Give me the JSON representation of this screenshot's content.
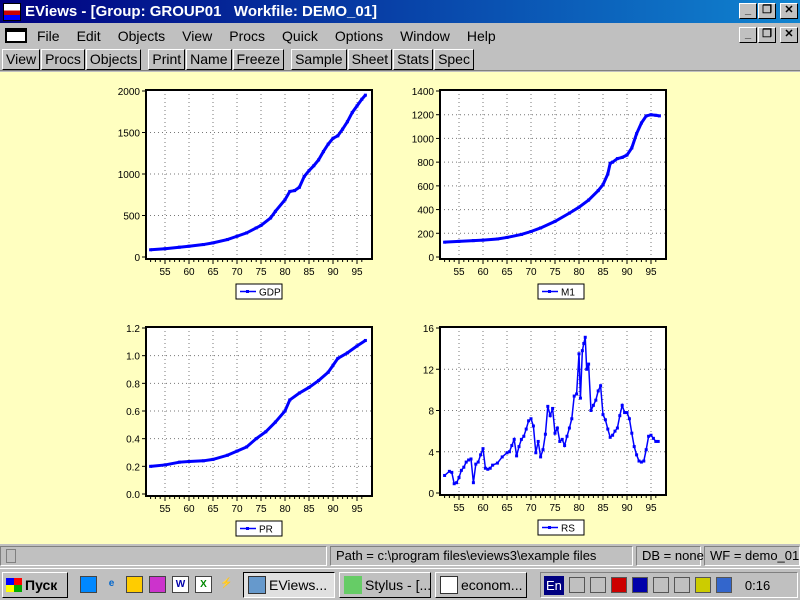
{
  "window": {
    "title": "EViews - [Group: GROUP01   Workfile: DEMO_01]",
    "controls": [
      "_",
      "❐",
      "✕"
    ]
  },
  "menu": [
    "File",
    "Edit",
    "Objects",
    "View",
    "Procs",
    "Quick",
    "Options",
    "Window",
    "Help"
  ],
  "toolbar": {
    "group1": [
      "View",
      "Procs",
      "Objects"
    ],
    "group2": [
      "Print",
      "Name",
      "Freeze"
    ],
    "group3": [
      "Sample",
      "Sheet",
      "Stats",
      "Spec"
    ]
  },
  "colors": {
    "background": "#ffffc0",
    "series": "#0000ff",
    "titlebar": "#000080"
  },
  "chart_data": [
    {
      "type": "line",
      "legend": "GDP",
      "ylim": [
        0,
        2000
      ],
      "yticks": [
        "0",
        "500",
        "1000",
        "1500",
        "2000"
      ],
      "yvals": [
        0,
        500,
        1000,
        1500,
        2000
      ],
      "xticks": [
        "55",
        "60",
        "65",
        "70",
        "75",
        "80",
        "85",
        "90",
        "95"
      ],
      "x": [
        52,
        55,
        58,
        60,
        63,
        65,
        68,
        70,
        72,
        74,
        75,
        77,
        78,
        80,
        81,
        82,
        83,
        84,
        85,
        86,
        87,
        88,
        89,
        90,
        91,
        92,
        93,
        94,
        95,
        96,
        96.75
      ],
      "y": [
        87,
        100,
        118,
        130,
        150,
        170,
        210,
        250,
        290,
        350,
        380,
        470,
        550,
        690,
        790,
        800,
        840,
        970,
        1040,
        1100,
        1170,
        1270,
        1360,
        1430,
        1460,
        1540,
        1630,
        1740,
        1820,
        1900,
        1950
      ]
    },
    {
      "type": "line",
      "legend": "M1",
      "ylim": [
        0,
        1400
      ],
      "yticks": [
        "0",
        "200",
        "400",
        "600",
        "800",
        "1000",
        "1200",
        "1400"
      ],
      "yvals": [
        0,
        200,
        400,
        600,
        800,
        1000,
        1200,
        1400
      ],
      "xticks": [
        "55",
        "60",
        "65",
        "70",
        "75",
        "80",
        "85",
        "90",
        "95"
      ],
      "x": [
        52,
        55,
        58,
        60,
        63,
        65,
        68,
        70,
        72,
        75,
        78,
        80,
        82,
        84,
        85,
        86,
        86.5,
        87,
        88,
        89,
        90,
        91,
        92,
        93,
        94,
        95,
        96,
        96.75
      ],
      "y": [
        125,
        132,
        138,
        142,
        152,
        165,
        190,
        215,
        245,
        300,
        370,
        420,
        480,
        560,
        610,
        700,
        790,
        800,
        830,
        840,
        860,
        920,
        1040,
        1130,
        1190,
        1200,
        1195,
        1190
      ]
    },
    {
      "type": "line",
      "legend": "PR",
      "ylim": [
        0,
        1.2
      ],
      "yticks": [
        "0.0",
        "0.2",
        "0.4",
        "0.6",
        "0.8",
        "1.0",
        "1.2"
      ],
      "yvals": [
        0,
        0.2,
        0.4,
        0.6,
        0.8,
        1.0,
        1.2
      ],
      "xticks": [
        "55",
        "60",
        "65",
        "70",
        "75",
        "80",
        "85",
        "90",
        "95"
      ],
      "x": [
        52,
        55,
        58,
        60,
        63,
        65,
        68,
        70,
        72,
        74,
        76,
        78,
        80,
        81,
        83,
        85,
        87,
        89,
        90,
        91,
        93,
        95,
        96.75
      ],
      "y": [
        0.2,
        0.21,
        0.23,
        0.235,
        0.24,
        0.25,
        0.28,
        0.31,
        0.34,
        0.4,
        0.45,
        0.52,
        0.6,
        0.68,
        0.73,
        0.77,
        0.82,
        0.88,
        0.93,
        0.98,
        1.02,
        1.07,
        1.11
      ]
    },
    {
      "type": "line",
      "legend": "RS",
      "ylim": [
        0,
        16
      ],
      "yticks": [
        "0",
        "4",
        "8",
        "12",
        "16"
      ],
      "yvals": [
        0,
        4,
        8,
        12,
        16
      ],
      "xticks": [
        "55",
        "60",
        "65",
        "70",
        "75",
        "80",
        "85",
        "90",
        "95"
      ],
      "x": [
        52,
        53,
        53.5,
        54,
        54.5,
        55,
        55.5,
        56,
        56.5,
        57,
        57.5,
        58,
        58.5,
        59,
        59.5,
        60,
        60.5,
        61,
        61.5,
        62,
        63,
        64,
        65,
        65.5,
        66,
        66.5,
        67,
        67.5,
        68,
        68.5,
        69,
        69.5,
        70,
        70.5,
        71,
        71.5,
        72,
        72.5,
        73,
        73.5,
        74,
        74.5,
        75,
        75.5,
        76,
        76.5,
        77,
        77.5,
        78,
        78.5,
        79,
        79.5,
        80,
        80.3,
        80.7,
        81,
        81.3,
        81.6,
        82,
        82.5,
        83,
        83.5,
        84,
        84.5,
        85,
        85.5,
        86,
        86.5,
        87,
        87.5,
        88,
        88.5,
        89,
        89.5,
        90,
        90.5,
        91,
        91.5,
        92,
        92.5,
        93,
        93.5,
        94,
        94.5,
        95,
        95.5,
        96,
        96.5
      ],
      "y": [
        1.7,
        2.1,
        2.0,
        0.9,
        1.0,
        1.5,
        2.2,
        2.5,
        3.0,
        3.2,
        3.3,
        1.0,
        2.8,
        3.0,
        3.7,
        4.3,
        2.4,
        2.3,
        2.4,
        2.7,
        2.9,
        3.5,
        3.9,
        4.0,
        4.6,
        5.2,
        3.6,
        4.5,
        5.2,
        5.5,
        6.2,
        7.0,
        7.2,
        6.5,
        3.9,
        5.0,
        3.5,
        4.2,
        5.7,
        8.4,
        7.5,
        8.2,
        5.8,
        6.3,
        5.0,
        5.2,
        4.6,
        5.5,
        6.3,
        7.2,
        9.4,
        9.6,
        13.5,
        9.2,
        13.8,
        14.5,
        15.1,
        12.0,
        12.5,
        8.0,
        8.5,
        9.0,
        9.9,
        10.4,
        7.6,
        7.1,
        6.2,
        5.4,
        5.6,
        6.0,
        6.3,
        7.5,
        8.5,
        7.8,
        7.8,
        7.2,
        5.8,
        4.5,
        3.7,
        3.1,
        3.0,
        3.1,
        4.2,
        5.5,
        5.6,
        5.3,
        5.0,
        5.0
      ]
    }
  ],
  "status": {
    "path": "Path = c:\\program files\\eviews3\\example files",
    "db": "DB = none",
    "wf": "WF = demo_01"
  },
  "taskbar": {
    "start": "Пуск",
    "tasks": [
      "EViews...",
      "Stylus - [...",
      "econom..."
    ],
    "lang": "En",
    "clock": "0:16"
  }
}
